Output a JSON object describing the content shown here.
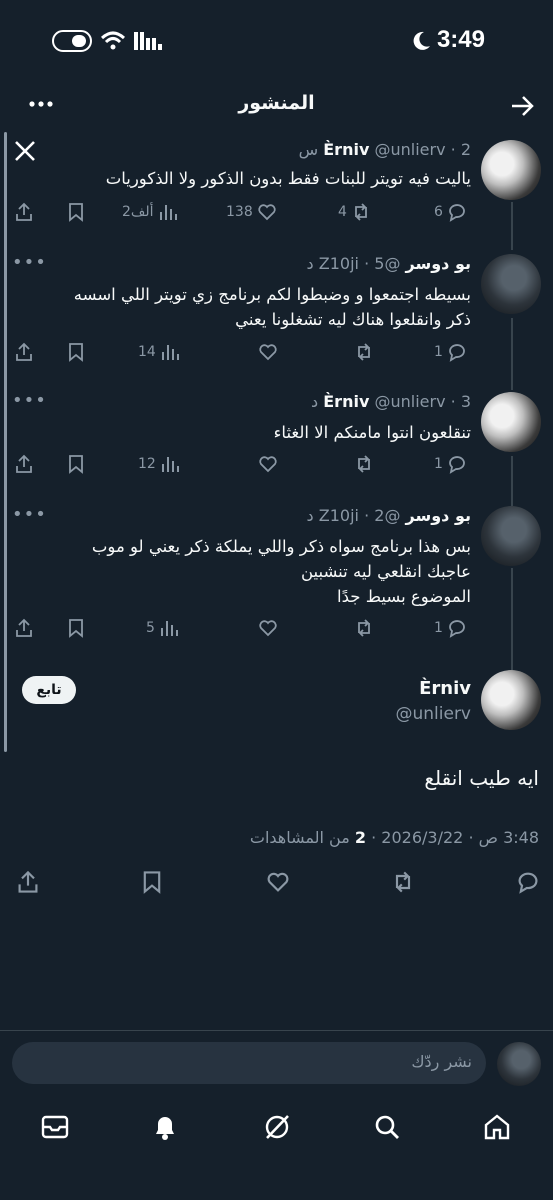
{
  "status_bar": {
    "time": "3:49"
  },
  "header": {
    "title": "المنشور",
    "back_icon": "arrow-right-icon",
    "more_icon": "more-icon"
  },
  "thread": [
    {
      "name": "Èrniv",
      "handle": "@unlierv",
      "time": "2 س",
      "sep": "·",
      "text": "ياليت فيه تويتر للبنات فقط بدون الذكور ولا الذكوريات",
      "views": "2ألف",
      "likes": "138",
      "reposts": "4",
      "replies": "6"
    },
    {
      "name": "بو دوسر",
      "handle": "@Z10ji",
      "time": "5 د",
      "sep": "·",
      "text": "بسيطه اجتمعوا و وضبطوا لكم برنامج زي تويتر اللي اسسه ذكر وانقلعوا هناك ليه تشغلونا يعني",
      "views": "14",
      "likes": "",
      "reposts": "",
      "replies": "1"
    },
    {
      "name": "Èrniv",
      "handle": "@unlierv",
      "time": "3 د",
      "sep": "·",
      "text": "تنقلعون انتوا مامنكم الا الغثاء",
      "views": "12",
      "likes": "",
      "reposts": "",
      "replies": "1"
    },
    {
      "name": "بو دوسر",
      "handle": "@Z10ji",
      "time": "2 د",
      "sep": "·",
      "text": "بس هذا برنامج سواه ذكر واللي يملكة ذكر يعني لو موب عاجبك انقلعي ليه تنشبين\nالموضوع بسيط جدًا",
      "views": "5",
      "likes": "",
      "reposts": "",
      "replies": "1"
    }
  ],
  "main_post": {
    "name": "Èrniv",
    "handle": "@unlierv",
    "follow_label": "تابع",
    "text": "ايه طيب انقلع",
    "date": "2026/3/22",
    "time": "3:48 ص",
    "dot": "·",
    "views_count": "2",
    "views_label": "من المشاهدات"
  },
  "reply": {
    "placeholder": "نشر ردّك"
  },
  "nav": {
    "items": [
      "home-icon",
      "search-icon",
      "grok-icon",
      "notifications-icon",
      "messages-icon"
    ]
  },
  "colors": {
    "background": "#15202b",
    "text": "#f7f9f9",
    "muted": "#8b98a5",
    "divider": "#38444d"
  }
}
